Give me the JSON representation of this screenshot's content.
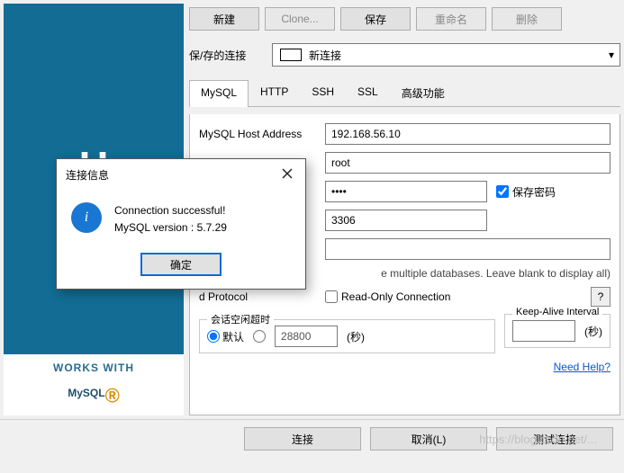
{
  "toolbar": {
    "new": "新建",
    "clone": "Clone...",
    "save": "保存",
    "rename": "重命名",
    "delete": "删除"
  },
  "saved": {
    "label": "保/存的连接",
    "selected": "新连接"
  },
  "tabs": {
    "mysql": "MySQL",
    "http": "HTTP",
    "ssh": "SSH",
    "ssl": "SSL",
    "advanced": "高级功能"
  },
  "form": {
    "hostLabel": "MySQL Host Address",
    "host": "192.168.56.10",
    "user": "root",
    "password": "••••",
    "savePwd": "保存密码",
    "port": "3306",
    "extra": "",
    "multiHint": "e multiple databases. Leave blank to display all)",
    "protocol": "d Protocol",
    "readOnly": "Read-Only Connection",
    "qmark": "?",
    "sessionLegend": "会话空闲超时",
    "defaultRadio": "默认",
    "customValue": "28800",
    "secUnit": "(秒)",
    "keepAliveLegend": "Keep-Alive Interval"
  },
  "logo": {
    "works": "WORKS WITH",
    "mysql": "MySQL"
  },
  "help": "Need Help?",
  "bottom": {
    "connect": "连接",
    "cancel": "取消(L)",
    "test": "测试连接"
  },
  "modal": {
    "title": "连接信息",
    "msg1": "Connection successful!",
    "msg2": "MySQL version : 5.7.29",
    "ok": "确定"
  },
  "watermark": "https://blog.csdn.net/..."
}
